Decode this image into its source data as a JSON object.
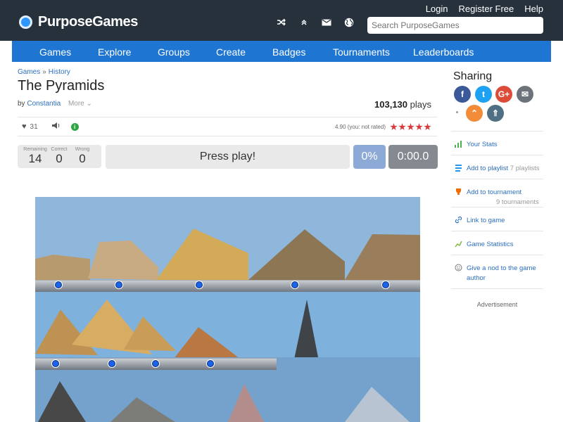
{
  "header": {
    "brand": "PurposeGames",
    "search_placeholder": "Search PurposeGames",
    "login": "Login",
    "register": "Register Free",
    "help": "Help",
    "icons": [
      "shuffle-icon",
      "double-chevron-up-icon",
      "mail-icon",
      "globe-icon"
    ]
  },
  "nav": [
    "Games",
    "Explore",
    "Groups",
    "Create",
    "Badges",
    "Tournaments",
    "Leaderboards"
  ],
  "page": {
    "breadcrumb": [
      "Games",
      "History"
    ],
    "title": "The Pyramids",
    "by": "by",
    "author": "Constantia",
    "more": "More",
    "plays_count": "103,130",
    "plays_label": "plays",
    "likes": "31",
    "rating_text": "4.90 (you: not rated)",
    "stars": 5
  },
  "game": {
    "remaining_label": "Remaining",
    "correct_label": "Correct",
    "wrong_label": "Wrong",
    "remaining": "14",
    "correct": "0",
    "wrong": "0",
    "press_play": "Press play!",
    "percent": "0%",
    "time": "0:00.0"
  },
  "sidebar": {
    "title": "Sharing",
    "share_buttons": [
      {
        "icon": "facebook-icon",
        "color": "#3b5998",
        "glyph": "f"
      },
      {
        "icon": "twitter-icon",
        "color": "#1da1f2",
        "glyph": "t"
      },
      {
        "icon": "googleplus-icon",
        "color": "#dd4b39",
        "glyph": "G+"
      },
      {
        "icon": "email-icon",
        "color": "#6c737a",
        "glyph": "✉"
      },
      {
        "icon": "upvote-icon",
        "color": "#f28c38",
        "glyph": "⌃"
      },
      {
        "icon": "double-up-icon",
        "color": "#4e6f84",
        "glyph": "⇑"
      }
    ],
    "items": [
      {
        "label": "Your Stats"
      },
      {
        "label": "Add to playlist",
        "extra": "7 playlists"
      },
      {
        "label": "Add to tournament",
        "extra": "9 tournaments"
      },
      {
        "label": "Link to game"
      },
      {
        "label": "Game Statistics"
      },
      {
        "label": "Give a nod to the game author"
      }
    ],
    "advertisement": "Advertisement"
  }
}
